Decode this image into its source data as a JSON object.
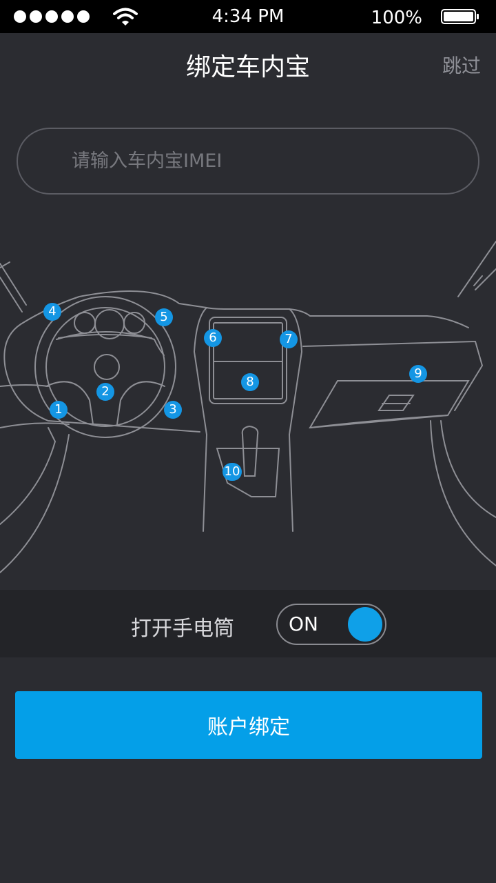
{
  "status_bar": {
    "time": "4:34 PM",
    "battery": "100%",
    "signal_icon": "signal-dots-icon",
    "wifi_icon": "wifi-icon",
    "battery_icon": "battery-full-icon"
  },
  "nav": {
    "title": "绑定车内宝",
    "skip_label": "跳过"
  },
  "imei_input": {
    "value": "",
    "placeholder": "请输入车内宝IMEI"
  },
  "car_markers": [
    "1",
    "2",
    "3",
    "4",
    "5",
    "6",
    "7",
    "8",
    "9",
    "10"
  ],
  "flashlight": {
    "label": "打开手电筒",
    "toggle_state": "ON"
  },
  "bind_button": {
    "label": "账户绑定"
  },
  "colors": {
    "background": "#2b2c31",
    "accent": "#049fe8",
    "marker": "#1496e4",
    "line": "#8e8f95"
  }
}
